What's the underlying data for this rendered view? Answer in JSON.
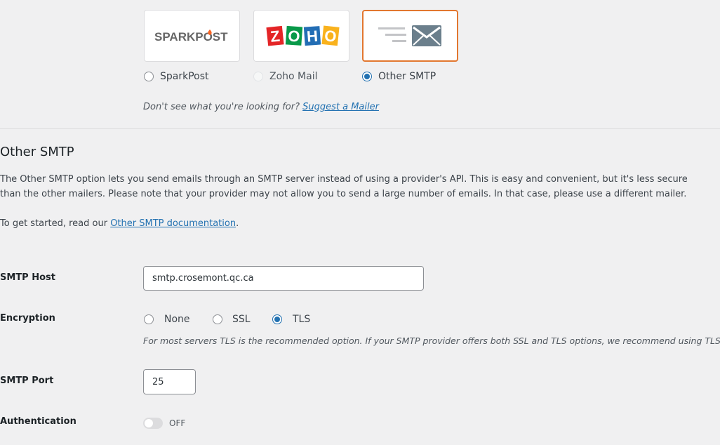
{
  "mailers": [
    {
      "logo_text": "SPARKPOST",
      "label": "SparkPost",
      "selected": false,
      "disabled": false
    },
    {
      "logo_text": "ZOHO",
      "label": "Zoho Mail",
      "selected": false,
      "disabled": true
    },
    {
      "logo_text": "",
      "label": "Other SMTP",
      "selected": true,
      "disabled": false
    }
  ],
  "suggest": {
    "prefix": "Don't see what you're looking for?",
    "link": "Suggest a Mailer"
  },
  "section": {
    "title": "Other SMTP",
    "description": "The Other SMTP option lets you send emails through an SMTP server instead of using a provider's API. This is easy and convenient, but it's less secure than the other mailers. Please note that your provider may not allow you to send a large number of emails. In that case, please use a different mailer.",
    "get_started_prefix": "To get started, read our",
    "get_started_link": "Other SMTP documentation",
    "get_started_suffix": "."
  },
  "fields": {
    "smtp_host": {
      "label": "SMTP Host",
      "value": "smtp.crosemont.qc.ca"
    },
    "encryption": {
      "label": "Encryption",
      "options": [
        "None",
        "SSL",
        "TLS"
      ],
      "selected": "TLS",
      "hint": "For most servers TLS is the recommended option. If your SMTP provider offers both SSL and TLS options, we recommend using TLS."
    },
    "smtp_port": {
      "label": "SMTP Port",
      "value": "25"
    },
    "authentication": {
      "label": "Authentication",
      "state": "OFF"
    }
  },
  "colors": {
    "accent_selected": "#e27730",
    "link": "#2271b1",
    "sparkpost_flame": "#fa6423"
  }
}
